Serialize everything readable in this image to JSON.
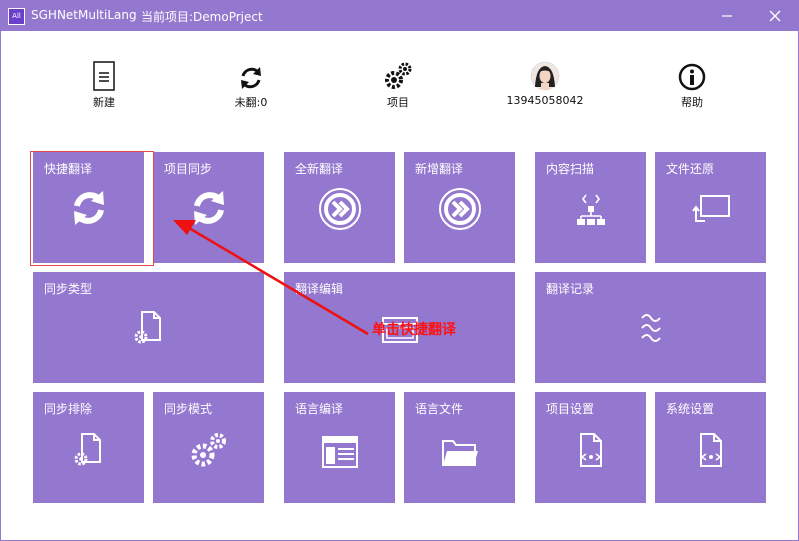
{
  "titlebar": {
    "app_icon_label": "All",
    "title": "SGHNetMultiLang",
    "project": "当前项目:DemoPrject"
  },
  "toolbar": {
    "new_label": "新建",
    "untranslated_label": "未翻:0",
    "project_label": "项目",
    "user_label": "13945058042",
    "help_label": "帮助"
  },
  "tiles": {
    "quick_translate": "快捷翻译",
    "project_sync": "项目同步",
    "full_translate": "全新翻译",
    "incremental_translate": "新增翻译",
    "content_scan": "内容扫描",
    "file_restore": "文件还原",
    "sync_type": "同步类型",
    "translation_edit": "翻译编辑",
    "translation_log": "翻译记录",
    "sync_exclude": "同步排除",
    "sync_mode": "同步模式",
    "language_edit": "语言编译",
    "language_file": "语言文件",
    "project_settings": "项目设置",
    "system_settings": "系统设置"
  },
  "annotation": {
    "text": "单击快捷翻译"
  },
  "colors": {
    "accent": "#9477cf",
    "annotation": "#ff1111"
  }
}
